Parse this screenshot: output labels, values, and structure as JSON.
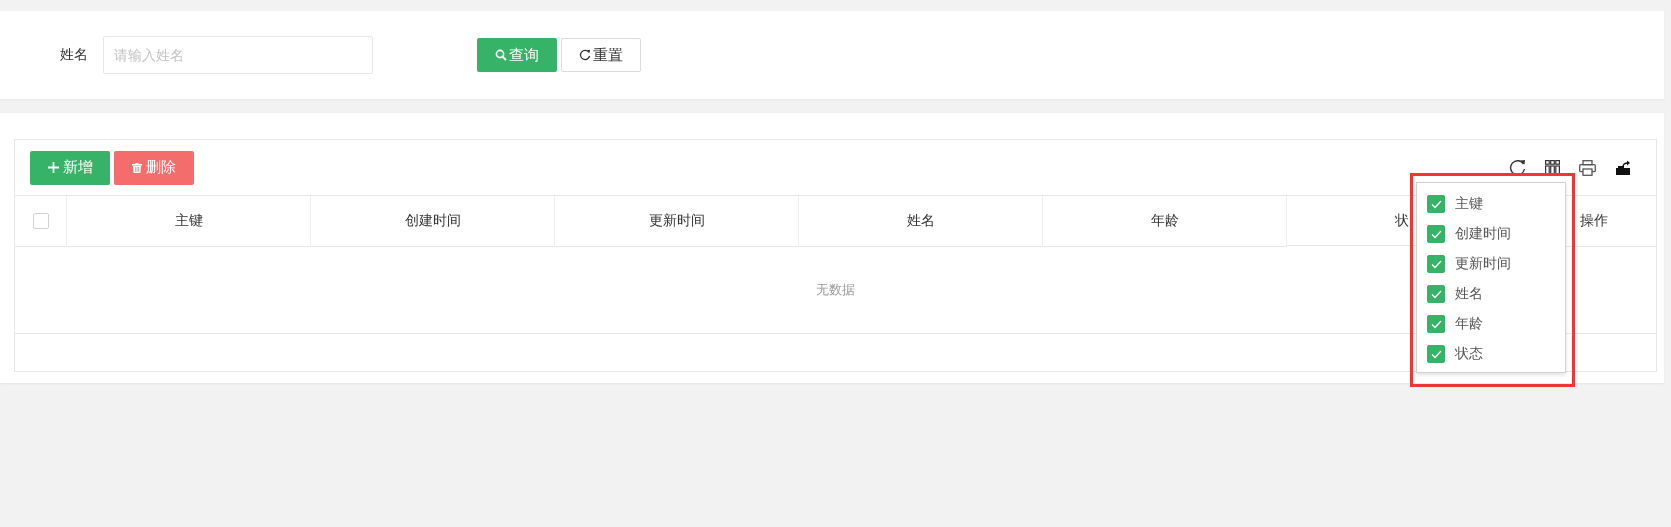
{
  "search_form": {
    "fields": [
      {
        "label": "姓名",
        "placeholder": "请输入姓名"
      }
    ],
    "buttons": [
      {
        "kind": "search",
        "label": "查询"
      },
      {
        "kind": "reset",
        "label": "重置"
      }
    ]
  },
  "toolbar": {
    "buttons": [
      {
        "kind": "add",
        "label": "新增"
      },
      {
        "kind": "delete",
        "label": "删除"
      }
    ],
    "tools": [
      {
        "kind": "refresh"
      },
      {
        "kind": "columns"
      },
      {
        "kind": "print"
      },
      {
        "kind": "export"
      }
    ]
  },
  "table": {
    "select_all": {
      "checked": false
    },
    "columns": [
      "主键",
      "创建时间",
      "更新时间",
      "姓名",
      "年龄",
      "状",
      "操作"
    ],
    "empty_text": "无数据"
  },
  "column_menu": {
    "items": [
      {
        "label": "主键",
        "checked": true
      },
      {
        "label": "创建时间",
        "checked": true
      },
      {
        "label": "更新时间",
        "checked": true
      },
      {
        "label": "姓名",
        "checked": true
      },
      {
        "label": "年龄",
        "checked": true
      },
      {
        "label": "状态",
        "checked": true
      }
    ]
  }
}
